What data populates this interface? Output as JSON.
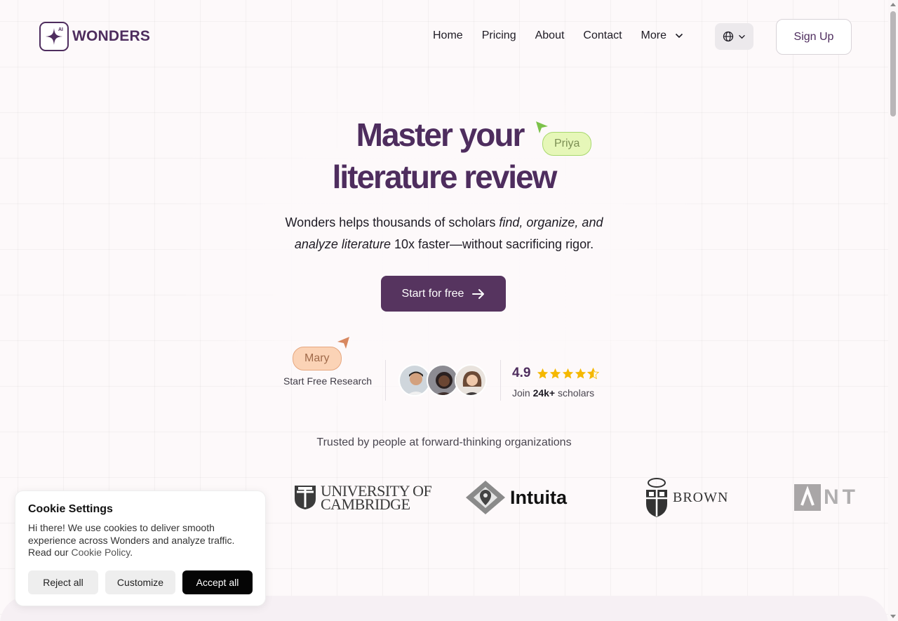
{
  "brand": {
    "name": "WONDERS",
    "logo_badge": "AI",
    "color": "#4e2d5e"
  },
  "nav": {
    "items": [
      "Home",
      "Pricing",
      "About",
      "Contact"
    ],
    "more_label": "More",
    "signup_label": "Sign Up"
  },
  "hero": {
    "title_line1": "Master your",
    "title_line2": "literature review",
    "subtitle_part1": "Wonders helps thousands of scholars ",
    "subtitle_em1": "find, organize, and",
    "subtitle_em2": "analyze literature",
    "subtitle_part2": " 10x faster—without sacrificing rigor.",
    "cta_label": "Start for free",
    "cursor_tags": [
      "Priya",
      "Mary"
    ]
  },
  "social_proof": {
    "free_research_label": "Start Free Research",
    "rating": "4.9",
    "stars": 4.5,
    "join_prefix": "Join ",
    "join_count": "24k+",
    "join_suffix": " scholars"
  },
  "trusted": {
    "heading": "Trusted by people at forward-thinking organizations",
    "orgs": [
      "UNIVERSITY OF",
      "CAMBRIDGE",
      "Intuita",
      "BROWN",
      "NT"
    ]
  },
  "cookie": {
    "title": "Cookie Settings",
    "body": "Hi there! We use cookies to deliver smooth experience across Wonders and analyze traffic. Read our ",
    "link": "Cookie Policy",
    "body_end": ".",
    "reject_label": "Reject all",
    "customize_label": "Customize",
    "accept_label": "Accept all"
  },
  "colors": {
    "accent": "#56345f",
    "star": "#f5b800",
    "priya_tag": "#e6f7b8",
    "mary_tag": "#fbd3b6"
  }
}
